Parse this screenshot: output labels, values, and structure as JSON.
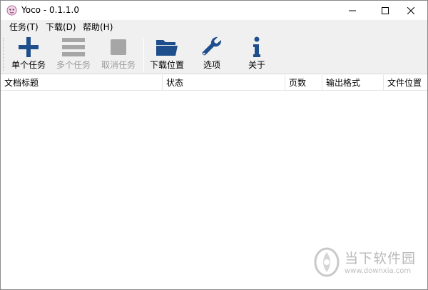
{
  "window": {
    "title": "Yoco - 0.1.1.0",
    "controls": {
      "minimize_icon": "minimize-icon",
      "maximize_icon": "maximize-icon",
      "close_icon": "close-icon"
    }
  },
  "menubar": {
    "items": [
      {
        "label": "任务(T)"
      },
      {
        "label": "下载(D)"
      },
      {
        "label": "帮助(H)"
      }
    ]
  },
  "toolbar": {
    "buttons": [
      {
        "label": "单个任务",
        "icon": "plus-icon",
        "enabled": true
      },
      {
        "label": "多个任务",
        "icon": "list-icon",
        "enabled": false
      },
      {
        "label": "取消任务",
        "icon": "stop-icon",
        "enabled": false
      },
      {
        "label": "下载位置",
        "icon": "folder-icon",
        "enabled": true
      },
      {
        "label": "选项",
        "icon": "wrench-icon",
        "enabled": true
      },
      {
        "label": "关于",
        "icon": "info-icon",
        "enabled": true
      }
    ]
  },
  "list": {
    "columns": [
      {
        "label": "文档标题"
      },
      {
        "label": "状态"
      },
      {
        "label": "页数"
      },
      {
        "label": "输出格式"
      },
      {
        "label": "文件位置"
      }
    ],
    "rows": []
  },
  "watermark": {
    "text": "当下软件园",
    "url": "www.downxia.com"
  },
  "colors": {
    "icon_blue": "#1f4e8c",
    "disabled_gray": "#a6a6a6",
    "toolbar_bg": "#f0f0f0"
  }
}
